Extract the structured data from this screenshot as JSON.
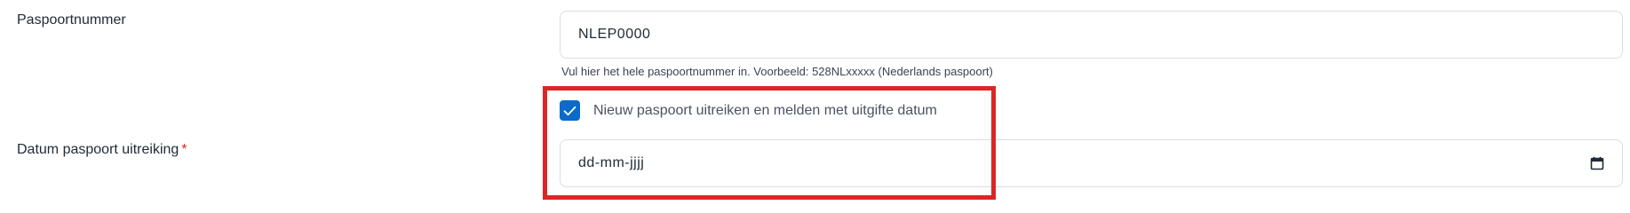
{
  "form": {
    "passport_number": {
      "label": "Paspoortnummer",
      "value": "NLEP0000",
      "hint": "Vul hier het hele paspoortnummer in. Voorbeeld: 528NLxxxxx (Nederlands paspoort)"
    },
    "new_passport_checkbox": {
      "label": "Nieuw paspoort uitreiken en melden met uitgifte datum",
      "checked": true
    },
    "issue_date": {
      "label": "Datum paspoort uitreiking",
      "required_marker": "*",
      "placeholder": "dd-mm-jjjj",
      "icon": "calendar-icon"
    }
  },
  "colors": {
    "accent": "#0b6bcb",
    "required": "#e02424",
    "highlight": "#dc2626",
    "border": "#d9dde3"
  }
}
